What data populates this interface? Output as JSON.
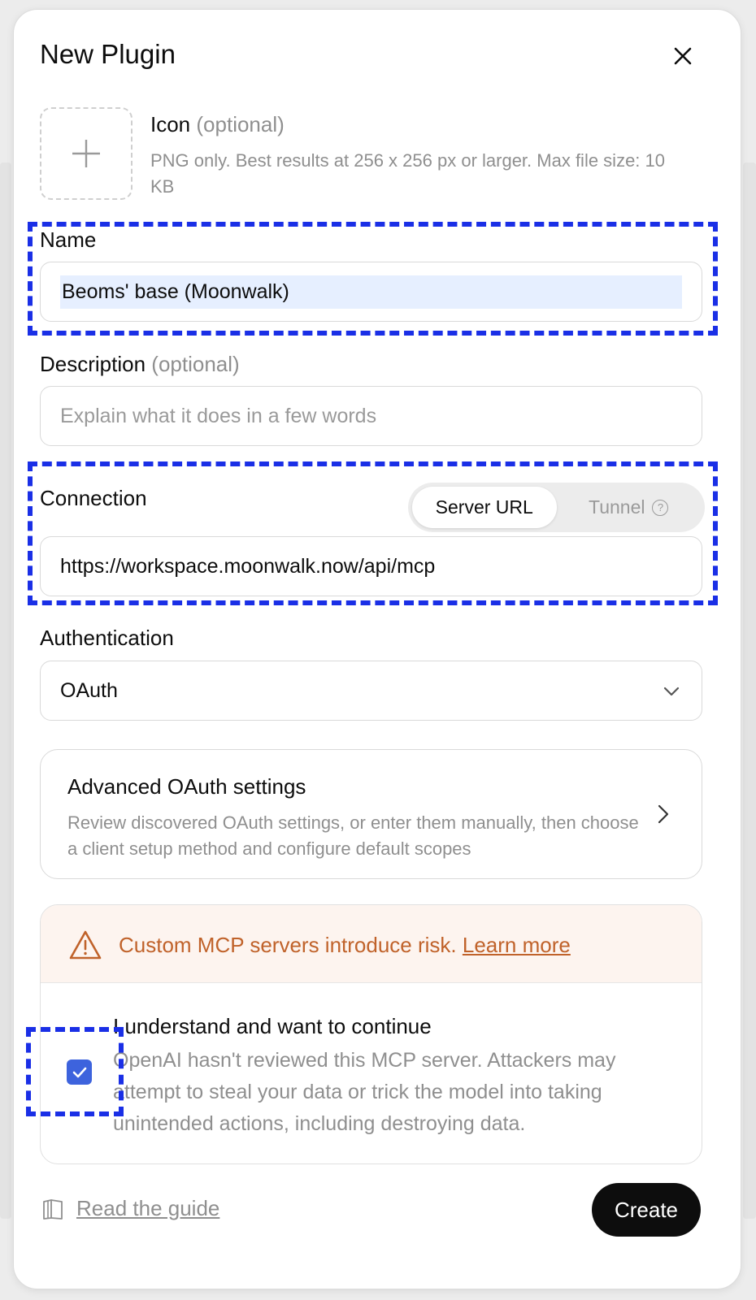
{
  "dialog": {
    "title": "New Plugin"
  },
  "icon_field": {
    "label": "Icon",
    "optional": "(optional)",
    "help": "PNG only. Best results at 256 x 256 px or larger. Max file size: 10 KB"
  },
  "name_field": {
    "label": "Name",
    "value": "Beoms' base (Moonwalk)"
  },
  "description_field": {
    "label": "Description",
    "optional": "(optional)",
    "placeholder": "Explain what it does in a few words"
  },
  "connection": {
    "label": "Connection",
    "options": [
      "Server URL",
      "Tunnel"
    ],
    "selected": "Server URL",
    "url": "https://workspace.moonwalk.now/api/mcp",
    "help_glyph": "?"
  },
  "authentication": {
    "label": "Authentication",
    "value": "OAuth"
  },
  "advanced": {
    "title": "Advanced OAuth settings",
    "description": "Review discovered OAuth settings, or enter them manually, then choose a client setup method and configure default scopes"
  },
  "warning": {
    "message": "Custom MCP servers introduce risk.",
    "link": "Learn more",
    "ack_title": "I understand and want to continue",
    "ack_description": "OpenAI hasn't reviewed this MCP server. Attackers may attempt to steal your data or trick the model into taking unintended actions, including destroying data.",
    "ack_checked": true,
    "accent_color": "#c0622a"
  },
  "footer": {
    "guide_link": "Read the guide",
    "create_label": "Create"
  },
  "highlight_color": "#1a2fe6",
  "checkbox_color": "#3d63dd"
}
